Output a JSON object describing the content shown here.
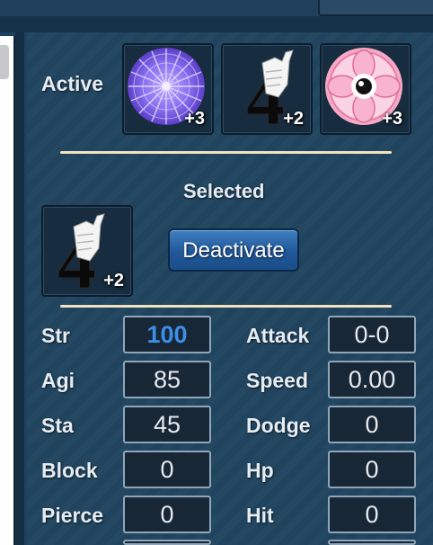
{
  "active_label": "Active",
  "selected_label": "Selected",
  "active_slots": [
    {
      "icon": "purple-mandala-icon",
      "level": "+3"
    },
    {
      "icon": "white-four-gauntlet-icon",
      "level": "+2"
    },
    {
      "icon": "pink-eye-flower-icon",
      "level": "+3"
    }
  ],
  "selected_slot": {
    "icon": "white-four-gauntlet-icon",
    "level": "+2"
  },
  "deactivate_label": "Deactivate",
  "stats_left": [
    {
      "label": "Str",
      "value": "100"
    },
    {
      "label": "Agi",
      "value": "85"
    },
    {
      "label": "Sta",
      "value": "45"
    },
    {
      "label": "Block",
      "value": "0"
    },
    {
      "label": "Pierce",
      "value": "0"
    }
  ],
  "stats_right": [
    {
      "label": "Attack",
      "value": "0-0"
    },
    {
      "label": "Speed",
      "value": "0.00"
    },
    {
      "label": "Dodge",
      "value": "0"
    },
    {
      "label": "Hp",
      "value": "0"
    },
    {
      "label": "Hit",
      "value": "0"
    }
  ],
  "colors": {
    "panel_bg": "#21455f",
    "highlight_value": "#3d8ee6",
    "divider": "#f2e2c0",
    "button": "#21589a"
  }
}
